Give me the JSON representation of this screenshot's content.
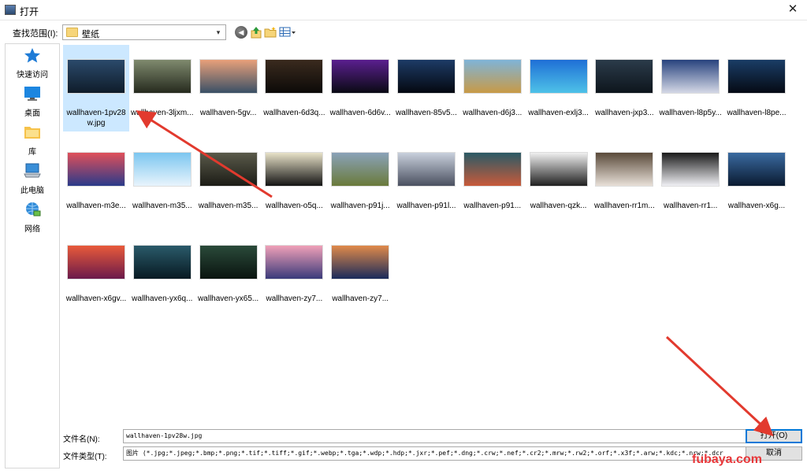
{
  "window": {
    "title": "打开",
    "close_glyph": "✕"
  },
  "lookin": {
    "label": "查找范围(I):",
    "value": "壁纸",
    "dropdown_glyph": "▾"
  },
  "toolbar": {
    "back_glyph": "◀"
  },
  "places": [
    {
      "label": "快速访问",
      "icon": "star-icon"
    },
    {
      "label": "桌面",
      "icon": "desktop-icon"
    },
    {
      "label": "库",
      "icon": "library-icon"
    },
    {
      "label": "此电脑",
      "icon": "computer-icon"
    },
    {
      "label": "网络",
      "icon": "network-icon"
    }
  ],
  "files": [
    {
      "name": "wallhaven-1pv28w.jpg",
      "selected": true,
      "c1": "#2b4a6b",
      "c2": "#0f1c2a"
    },
    {
      "name": "wallhaven-3ljxm...",
      "c1": "#7f8a6e",
      "c2": "#262a1e"
    },
    {
      "name": "wallhaven-5gv...",
      "c1": "#e8a07a",
      "c2": "#3a5066"
    },
    {
      "name": "wallhaven-6d3q...",
      "c1": "#3a2a1e",
      "c2": "#0c0a08"
    },
    {
      "name": "wallhaven-6d6v...",
      "c1": "#5b1f8f",
      "c2": "#0a0a14"
    },
    {
      "name": "wallhaven-85v5...",
      "c1": "#1d3b66",
      "c2": "#040810"
    },
    {
      "name": "wallhaven-d6j3...",
      "c1": "#7fb4d8",
      "c2": "#c89a46"
    },
    {
      "name": "wallhaven-exlj3...",
      "c1": "#1f6fd6",
      "c2": "#4ec2e8"
    },
    {
      "name": "wallhaven-jxp3...",
      "c1": "#2b3b4a",
      "c2": "#0d151c"
    },
    {
      "name": "wallhaven-l8p5y...",
      "c1": "#28437e",
      "c2": "#d4d8e6"
    },
    {
      "name": "wallhaven-l8pe...",
      "c1": "#1a3d66",
      "c2": "#050a14"
    },
    {
      "name": "wallhaven-m3e...",
      "c1": "#e0505a",
      "c2": "#2a3a8a"
    },
    {
      "name": "wallhaven-m35...",
      "c1": "#7cc6f0",
      "c2": "#e8f4fc"
    },
    {
      "name": "wallhaven-m35...",
      "c1": "#5a5a4a",
      "c2": "#1c1c16"
    },
    {
      "name": "wallhaven-o5q...",
      "c1": "#e8e2c8",
      "c2": "#141414"
    },
    {
      "name": "wallhaven-p91j...",
      "c1": "#8aa2b8",
      "c2": "#6a7a3a"
    },
    {
      "name": "wallhaven-p91l...",
      "c1": "#c8d0dc",
      "c2": "#4a5060"
    },
    {
      "name": "wallhaven-p91...",
      "c1": "#2a5a66",
      "c2": "#c85a3a"
    },
    {
      "name": "wallhaven-qzk...",
      "c1": "#f0f0f0",
      "c2": "#202020"
    },
    {
      "name": "wallhaven-rr1m...",
      "c1": "#5a4a3a",
      "c2": "#e8e0d8"
    },
    {
      "name": "wallhaven-rr1...",
      "c1": "#1a1a1a",
      "c2": "#f0f0f4"
    },
    {
      "name": "wallhaven-x6g...",
      "c1": "#3a6aa0",
      "c2": "#0a1a30"
    },
    {
      "name": "wallhaven-x6gv...",
      "c1": "#e85a3a",
      "c2": "#6a1a4a"
    },
    {
      "name": "wallhaven-yx6q...",
      "c1": "#2a5a6a",
      "c2": "#081a22"
    },
    {
      "name": "wallhaven-yx65...",
      "c1": "#2a4a3a",
      "c2": "#0a1410"
    },
    {
      "name": "wallhaven-zy7...",
      "c1": "#f0a0b8",
      "c2": "#3a3a7a"
    },
    {
      "name": "wallhaven-zy7...",
      "c1": "#e08a4a",
      "c2": "#1a2a5a"
    }
  ],
  "bottom": {
    "filename_label": "文件名(N):",
    "filename_value": "wallhaven-1pv28w.jpg",
    "filetype_label": "文件类型(T):",
    "filetype_value": "图片 (*.jpg;*.jpeg;*.bmp;*.png;*.tif;*.tiff;*.gif;*.webp;*.tga;*.wdp;*.hdp;*.jxr;*.pef;*.dng;*.crw;*.nef;*.cr2;*.mrw;*.rw2;*.orf;*.x3f;*.arw;*.kdc;*.nrw;*.dcr",
    "dropdown_glyph": "▾",
    "open_label": "打开(O)",
    "cancel_label": "取消"
  },
  "watermark": "fubaya.com",
  "colors": {
    "selection": "#cce8ff",
    "arrow": "#e23a2e",
    "accent": "#0078d7"
  }
}
